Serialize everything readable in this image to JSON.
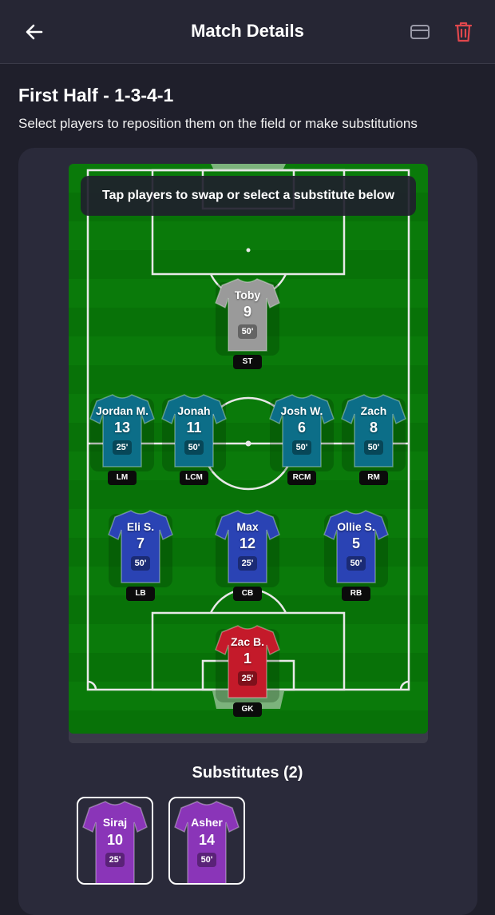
{
  "header": {
    "title": "Match Details",
    "icons": [
      "back-arrow-icon",
      "card-icon",
      "trash-icon"
    ],
    "trash_color": "#e0474c"
  },
  "section": {
    "title": "First Half - 1-3-4-1",
    "subtitle": "Select players to reposition them on the field or make substitutions"
  },
  "pitch": {
    "tip": "Tap players to swap or select a substitute below",
    "players": {
      "st": {
        "name": "Toby",
        "number": "9",
        "minutes": "50'",
        "position": "ST",
        "color": "#9a9a9a"
      },
      "lm": {
        "name": "Jordan M.",
        "number": "13",
        "minutes": "25'",
        "position": "LM",
        "color": "#0c6e88"
      },
      "lcm": {
        "name": "Jonah",
        "number": "11",
        "minutes": "50'",
        "position": "LCM",
        "color": "#0c6e88"
      },
      "rcm": {
        "name": "Josh W.",
        "number": "6",
        "minutes": "50'",
        "position": "RCM",
        "color": "#0c6e88"
      },
      "rm": {
        "name": "Zach",
        "number": "8",
        "minutes": "50'",
        "position": "RM",
        "color": "#0c6e88"
      },
      "lb": {
        "name": "Eli S.",
        "number": "7",
        "minutes": "50'",
        "position": "LB",
        "color": "#2a43b4"
      },
      "cb": {
        "name": "Max",
        "number": "12",
        "minutes": "25'",
        "position": "CB",
        "color": "#2a43b4"
      },
      "rb": {
        "name": "Ollie S.",
        "number": "5",
        "minutes": "50'",
        "position": "RB",
        "color": "#2a43b4"
      },
      "gk": {
        "name": "Zac B.",
        "number": "1",
        "minutes": "25'",
        "position": "GK",
        "color": "#c41a2a"
      }
    }
  },
  "substitutes": {
    "title": "Substitutes (2)",
    "players": [
      {
        "name": "Siraj",
        "number": "10",
        "minutes": "25'",
        "color": "#8a35b8"
      },
      {
        "name": "Asher",
        "number": "14",
        "minutes": "50'",
        "color": "#8a35b8"
      }
    ]
  }
}
